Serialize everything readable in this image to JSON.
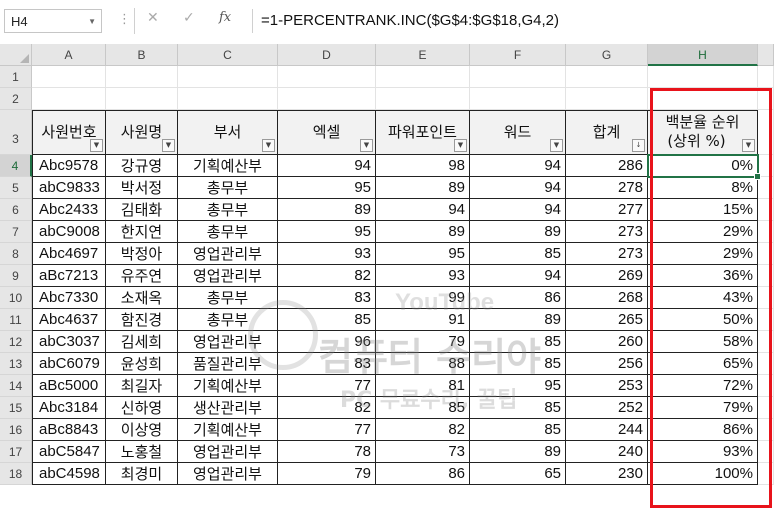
{
  "formula_bar": {
    "name_box": "H4",
    "cancel": "✕",
    "enter": "✓",
    "fx": "fx",
    "formula": "=1-PERCENTRANK.INC($G$4:$G$18,G4,2)"
  },
  "columns": [
    "A",
    "B",
    "C",
    "D",
    "E",
    "F",
    "G",
    "H"
  ],
  "rows": [
    "1",
    "2",
    "3",
    "4",
    "5",
    "6",
    "7",
    "8",
    "9",
    "10",
    "11",
    "12",
    "13",
    "14",
    "15",
    "16",
    "17",
    "18"
  ],
  "table": {
    "headers": [
      "사원번호",
      "사원명",
      "부서",
      "엑셀",
      "파워포인트",
      "워드",
      "합계"
    ],
    "header_h_line1": "백분율 순위",
    "header_h_line2": "(상위 %)",
    "data": [
      [
        "Abc9578",
        "강규영",
        "기획예산부",
        "94",
        "98",
        "94",
        "286",
        "0%"
      ],
      [
        "abC9833",
        "박서정",
        "총무부",
        "95",
        "89",
        "94",
        "278",
        "8%"
      ],
      [
        "Abc2433",
        "김태화",
        "총무부",
        "89",
        "94",
        "94",
        "277",
        "15%"
      ],
      [
        "abC9008",
        "한지연",
        "총무부",
        "95",
        "89",
        "89",
        "273",
        "29%"
      ],
      [
        "Abc4697",
        "박정아",
        "영업관리부",
        "93",
        "95",
        "85",
        "273",
        "29%"
      ],
      [
        "aBc7213",
        "유주연",
        "영업관리부",
        "82",
        "93",
        "94",
        "269",
        "36%"
      ],
      [
        "Abc7330",
        "소재옥",
        "총무부",
        "83",
        "99",
        "86",
        "268",
        "43%"
      ],
      [
        "Abc4637",
        "함진경",
        "총무부",
        "85",
        "91",
        "89",
        "265",
        "50%"
      ],
      [
        "abC3037",
        "김세희",
        "영업관리부",
        "96",
        "79",
        "85",
        "260",
        "58%"
      ],
      [
        "abC6079",
        "윤성희",
        "품질관리부",
        "83",
        "88",
        "85",
        "256",
        "65%"
      ],
      [
        "aBc5000",
        "최길자",
        "기획예산부",
        "77",
        "81",
        "95",
        "253",
        "72%"
      ],
      [
        "Abc3184",
        "신하영",
        "생산관리부",
        "82",
        "85",
        "85",
        "252",
        "79%"
      ],
      [
        "aBc8843",
        "이상영",
        "기획예산부",
        "77",
        "82",
        "85",
        "244",
        "86%"
      ],
      [
        "abC5847",
        "노홍철",
        "영업관리부",
        "78",
        "73",
        "89",
        "240",
        "93%"
      ],
      [
        "abC4598",
        "최경미",
        "영업관리부",
        "79",
        "86",
        "65",
        "230",
        "100%"
      ]
    ]
  },
  "watermark": {
    "line1": "컴퓨터 수리야",
    "line2": "PC 무료수리, 꿀팁",
    "line3": "YouTube"
  },
  "colors": {
    "accent": "#217346",
    "highlight": "#e8131b"
  }
}
